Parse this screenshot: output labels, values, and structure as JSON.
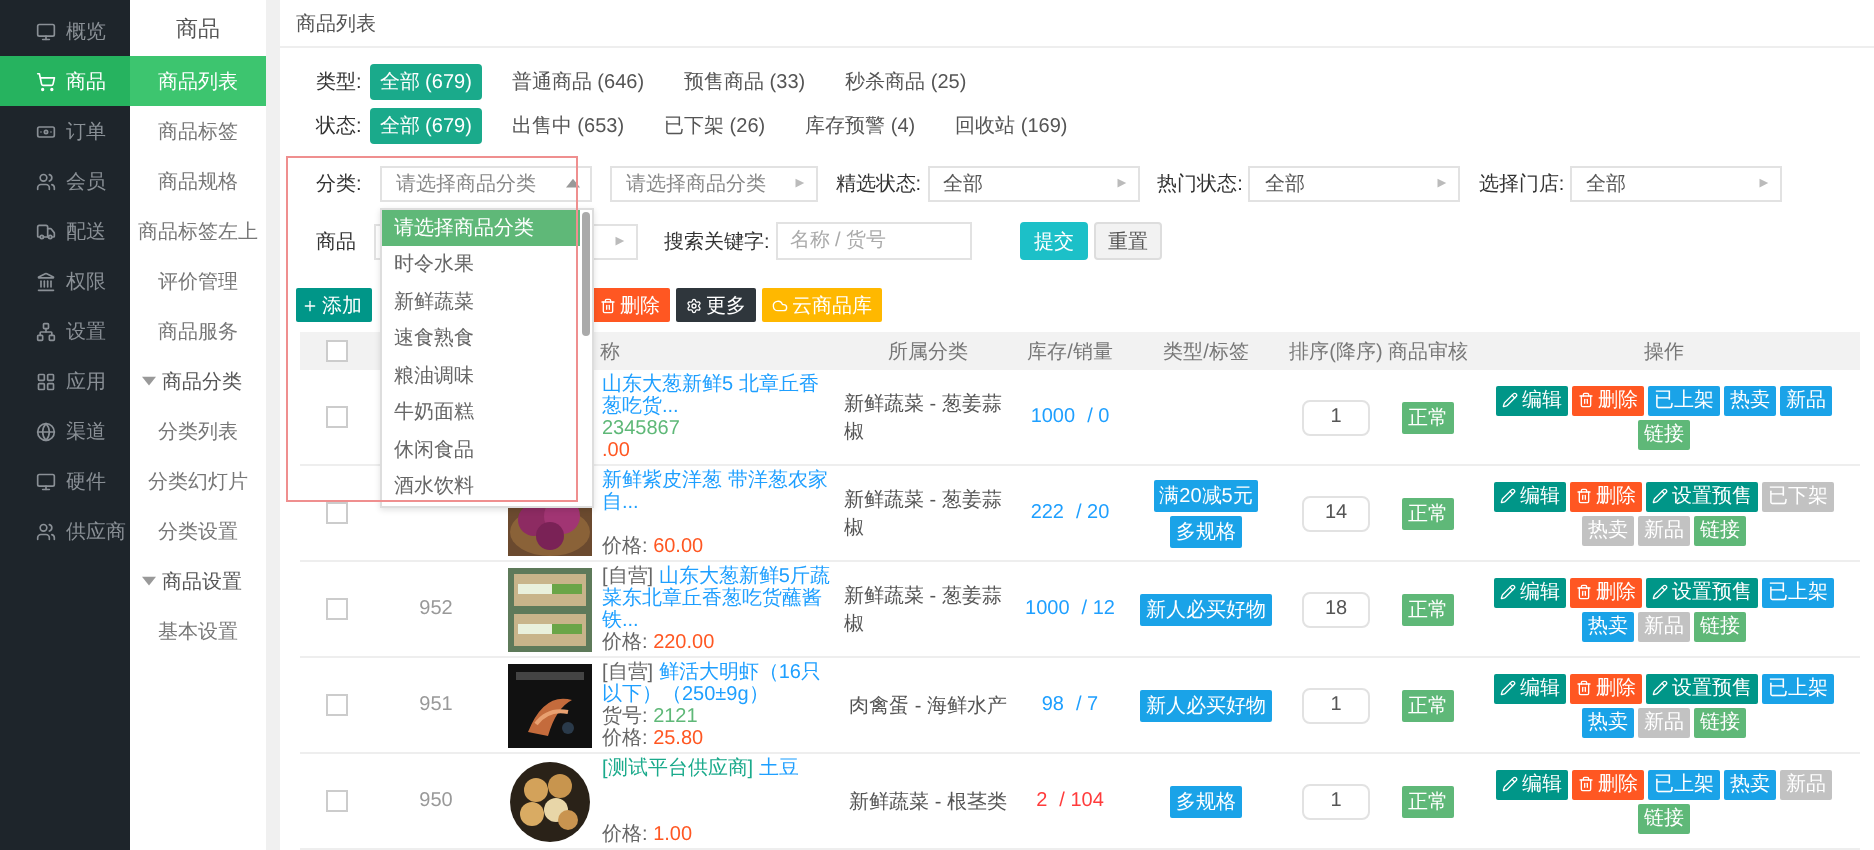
{
  "sidebar": {
    "items": [
      {
        "label": "概览",
        "selected": false
      },
      {
        "label": "商品",
        "selected": true
      },
      {
        "label": "订单",
        "selected": false
      },
      {
        "label": "会员",
        "selected": false
      },
      {
        "label": "配送",
        "selected": false
      },
      {
        "label": "权限",
        "selected": false
      },
      {
        "label": "设置",
        "selected": false
      },
      {
        "label": "应用",
        "selected": false
      },
      {
        "label": "渠道",
        "selected": false
      },
      {
        "label": "硬件",
        "selected": false
      },
      {
        "label": "供应商",
        "selected": false
      }
    ]
  },
  "subnav": {
    "title": "商品",
    "items": [
      {
        "label": "商品列表",
        "selected": true
      },
      {
        "label": "商品标签",
        "selected": false
      },
      {
        "label": "商品规格",
        "selected": false
      },
      {
        "label": "商品标签左上",
        "selected": false
      },
      {
        "label": "评价管理",
        "selected": false
      },
      {
        "label": "商品服务",
        "selected": false
      },
      {
        "label": "商品分类",
        "expanded": true,
        "children": [
          {
            "label": "分类列表",
            "selected": false
          },
          {
            "label": "分类幻灯片",
            "selected": false
          },
          {
            "label": "分类设置",
            "selected": false
          }
        ]
      },
      {
        "label": "商品设置",
        "expanded": true,
        "children": [
          {
            "label": "基本设置",
            "selected": false
          }
        ]
      }
    ]
  },
  "page_title": "商品列表",
  "chip_filters": [
    {
      "label": "类型:",
      "options": [
        {
          "label": "全部 (679)",
          "selected": true
        },
        {
          "label": "普通商品 (646)",
          "selected": false
        },
        {
          "label": "预售商品 (33)",
          "selected": false
        },
        {
          "label": "秒杀商品 (25)",
          "selected": false
        }
      ]
    },
    {
      "label": "状态:",
      "options": [
        {
          "label": "全部 (679)",
          "selected": true
        },
        {
          "label": "出售中 (653)",
          "selected": false
        },
        {
          "label": "已下架 (26)",
          "selected": false
        },
        {
          "label": "库存预警 (4)",
          "selected": false
        },
        {
          "label": "回收站 (169)",
          "selected": false
        }
      ]
    }
  ],
  "select_filters": [
    {
      "label": "分类:",
      "placeholder": "请选择商品分类",
      "expanded": true
    },
    {
      "placeholder": "请选择商品分类",
      "expanded": false
    },
    {
      "label": "精选状态:",
      "value": "全部",
      "expanded": false
    },
    {
      "label": "热门状态:",
      "value": "全部",
      "expanded": false
    },
    {
      "label": "选择门店:",
      "value": "全部",
      "expanded": false
    }
  ],
  "category_dropdown": [
    {
      "label": "请选择商品分类",
      "selected": true
    },
    {
      "label": "时令水果",
      "selected": false
    },
    {
      "label": "新鲜蔬菜",
      "selected": false
    },
    {
      "label": "速食熟食",
      "selected": false
    },
    {
      "label": "粮油调味",
      "selected": false
    },
    {
      "label": "牛奶面糕",
      "selected": false
    },
    {
      "label": "休闲食品",
      "selected": false
    },
    {
      "label": "酒水饮料",
      "selected": false
    }
  ],
  "audit_filter": {
    "label": "商品",
    "expanded": false
  },
  "search": {
    "label": "搜索关键字:",
    "placeholder": "名称 / 货号"
  },
  "form_buttons": [
    {
      "label": "提交",
      "kind": "primary"
    },
    {
      "label": "重置",
      "kind": "plain"
    }
  ],
  "toolbar": [
    {
      "label": "添加",
      "kind": "add"
    },
    {
      "label": "删除",
      "kind": "delete"
    },
    {
      "label": "更多",
      "kind": "more"
    },
    {
      "label": "云商品库",
      "kind": "cloud"
    }
  ],
  "table": {
    "header_checked": false,
    "columns": [
      "称",
      "所属分类",
      "库存/销量",
      "类型/标签",
      "排序(降序)",
      "商品审核",
      "操作"
    ],
    "rows": [
      {
        "checked": false,
        "product": {
          "name": "山东大葱新鲜5 北章丘香葱吃货...",
          "sku": "2345867",
          "price": ".00"
        },
        "category": "新鲜蔬菜 - 葱姜蒜椒",
        "stock": "1000",
        "sales": "/ 0",
        "low": false,
        "tags": [],
        "sort": "1",
        "audit": "正常",
        "ops": [
          {
            "label": "编辑",
            "kind": "edit"
          },
          {
            "label": "删除",
            "kind": "delete"
          },
          {
            "label": "已上架",
            "kind": "toggle",
            "on": true
          },
          {
            "label": "热卖",
            "kind": "toggle",
            "on": true
          },
          {
            "label": "新品",
            "kind": "toggle",
            "on": true
          },
          {
            "label": "链接",
            "kind": "link"
          }
        ]
      },
      {
        "checked": false,
        "product": {
          "image": {
            "kind": "picture",
            "clipped": true
          },
          "name": "新鲜紫皮洋葱 带洋葱农家自...",
          "price_label": "价格:",
          "price": "60.00"
        },
        "category": "新鲜蔬菜 - 葱姜蒜椒",
        "stock": "222",
        "sales": "/ 20",
        "low": false,
        "tags": [
          "满20减5元",
          "多规格"
        ],
        "sort": "14",
        "audit": "正常",
        "ops": [
          {
            "label": "编辑",
            "kind": "edit"
          },
          {
            "label": "删除",
            "kind": "delete"
          },
          {
            "label": "设置预售",
            "kind": "presale"
          },
          {
            "label": "已下架",
            "kind": "toggle",
            "on": false
          },
          {
            "label": "热卖",
            "kind": "toggle",
            "on": false
          },
          {
            "label": "新品",
            "kind": "toggle",
            "on": false
          },
          {
            "label": "链接",
            "kind": "link"
          }
        ]
      },
      {
        "checked": false,
        "id": "952",
        "product": {
          "image": {
            "kind": "picture"
          },
          "source": {
            "text": "[自营]",
            "color": "#666666"
          },
          "name": "山东大葱新鲜5斤蔬菜东北章丘香葱吃货蘸酱铁...",
          "price_label": "价格:",
          "price": "220.00"
        },
        "category": "新鲜蔬菜 - 葱姜蒜椒",
        "stock": "1000",
        "sales": "/ 12",
        "low": false,
        "tags": [
          "新人必买好物"
        ],
        "sort": "18",
        "audit": "正常",
        "ops": [
          {
            "label": "编辑",
            "kind": "edit"
          },
          {
            "label": "删除",
            "kind": "delete"
          },
          {
            "label": "设置预售",
            "kind": "presale"
          },
          {
            "label": "已上架",
            "kind": "toggle",
            "on": true
          },
          {
            "label": "热卖",
            "kind": "toggle",
            "on": true
          },
          {
            "label": "新品",
            "kind": "toggle",
            "on": false
          },
          {
            "label": "链接",
            "kind": "link"
          }
        ]
      },
      {
        "checked": false,
        "id": "951",
        "product": {
          "image": {
            "kind": "picture"
          },
          "source": {
            "text": "[自营]",
            "color": "#666666"
          },
          "name": "鲜活大明虾（16只以下）（250±9g）",
          "sku_label": "货号:",
          "sku": "2121",
          "price_label": "价格:",
          "price": "25.80"
        },
        "category": "肉禽蛋 - 海鲜水产",
        "stock": "98",
        "sales": "/ 7",
        "low": false,
        "tags": [
          "新人必买好物"
        ],
        "sort": "1",
        "audit": "正常",
        "ops": [
          {
            "label": "编辑",
            "kind": "edit"
          },
          {
            "label": "删除",
            "kind": "delete"
          },
          {
            "label": "设置预售",
            "kind": "presale"
          },
          {
            "label": "已上架",
            "kind": "toggle",
            "on": true
          },
          {
            "label": "热卖",
            "kind": "toggle",
            "on": true
          },
          {
            "label": "新品",
            "kind": "toggle",
            "on": false
          },
          {
            "label": "链接",
            "kind": "link"
          }
        ]
      },
      {
        "checked": false,
        "id": "950",
        "product": {
          "image": {
            "kind": "picture"
          },
          "source": {
            "text": "[测试平台供应商]",
            "color": "#1aaa8b"
          },
          "name": "土豆",
          "price_label": "价格:",
          "price": "1.00"
        },
        "category": "新鲜蔬菜 - 根茎类",
        "stock": "2",
        "sales": "/ 104",
        "low": true,
        "tags": [
          "多规格"
        ],
        "sort": "1",
        "audit": "正常",
        "ops": [
          {
            "label": "编辑",
            "kind": "edit"
          },
          {
            "label": "删除",
            "kind": "delete"
          },
          {
            "label": "已上架",
            "kind": "toggle",
            "on": true
          },
          {
            "label": "热卖",
            "kind": "toggle",
            "on": true
          },
          {
            "label": "新品",
            "kind": "toggle",
            "on": false
          },
          {
            "label": "链接",
            "kind": "link"
          }
        ]
      }
    ]
  }
}
